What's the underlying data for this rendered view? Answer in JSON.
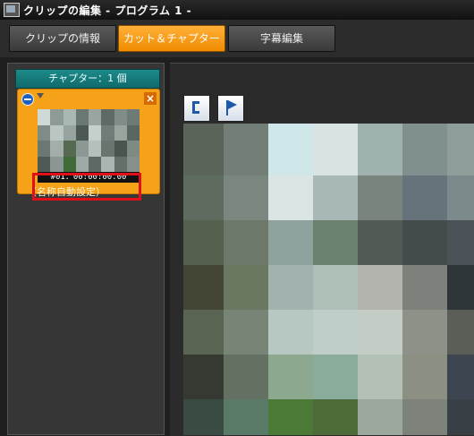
{
  "window": {
    "title": "クリップの編集 - プログラム 1 -"
  },
  "tabs": [
    {
      "label": "クリップの情報",
      "active": false
    },
    {
      "label": "カット＆チャプター",
      "active": true
    },
    {
      "label": "字幕編集",
      "active": false
    }
  ],
  "chapters": {
    "header": "チャプター：1 個",
    "items": [
      {
        "timecode": "#01：00:00:00.00",
        "name": "（名称自動設定）"
      }
    ]
  },
  "toolbar": {
    "icons": [
      "in-point-bracket-icon",
      "chapter-flag-icon"
    ]
  },
  "colors": {
    "accent": "#f5a219",
    "teal": "#1e8a8a",
    "annotation": "#e0101a"
  }
}
